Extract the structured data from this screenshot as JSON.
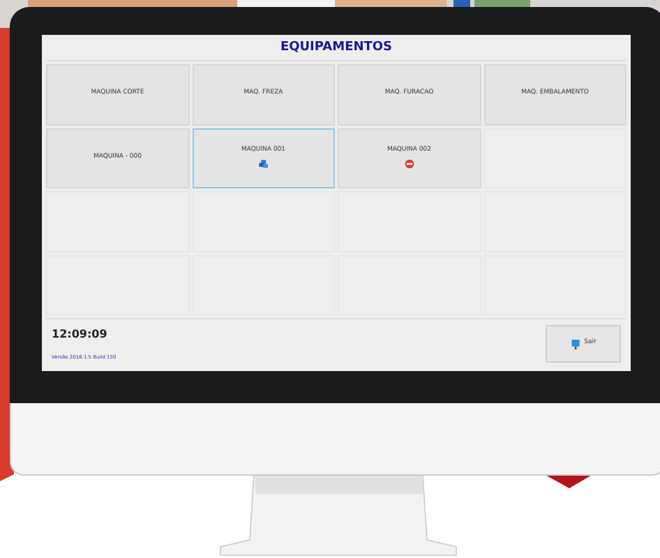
{
  "window": {
    "title": "EQUIPAMENTOS"
  },
  "tiles": [
    {
      "kind": "idle",
      "label": "MAQUINA CORTE",
      "selected": false
    },
    {
      "kind": "idle",
      "label": "MAQ. FREZA",
      "selected": false
    },
    {
      "kind": "idle",
      "label": "MAQ. FURACAO",
      "selected": false
    },
    {
      "kind": "idle",
      "label": "MAQ. EMBALAMENTO",
      "selected": false
    },
    {
      "kind": "idle",
      "label": "MAQUINA - 000",
      "selected": false
    },
    {
      "kind": "running",
      "label": "MAQUINA 001",
      "selected": true
    },
    {
      "kind": "stopped",
      "label": "MAQUINA 002",
      "selected": false
    },
    {
      "kind": "empty"
    },
    {
      "kind": "empty"
    },
    {
      "kind": "empty"
    },
    {
      "kind": "empty"
    },
    {
      "kind": "empty"
    },
    {
      "kind": "empty"
    },
    {
      "kind": "empty"
    },
    {
      "kind": "empty"
    },
    {
      "kind": "empty"
    }
  ],
  "clock": "12:09:09",
  "version": "Versão 2016.1.5 Build 150",
  "exit_button": "Sair"
}
